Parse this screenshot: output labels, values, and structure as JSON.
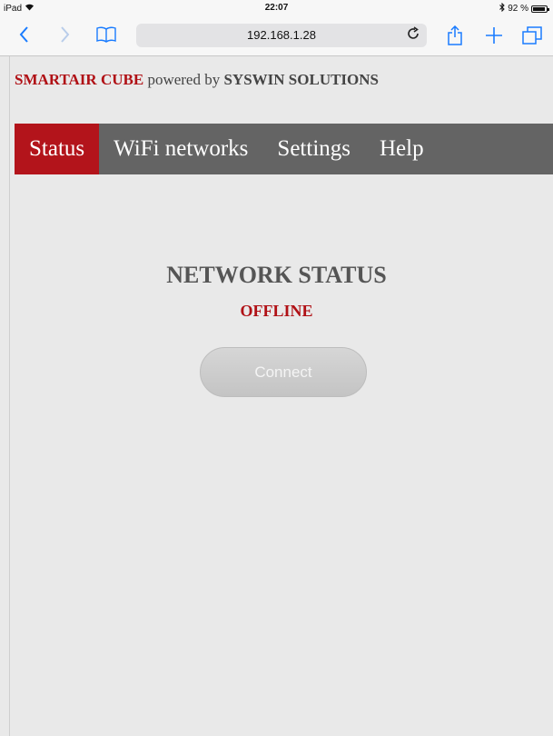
{
  "status_bar": {
    "device": "iPad",
    "time": "22:07",
    "battery_text": "92 %",
    "battery_level": 0.92
  },
  "browser": {
    "url": "192.168.1.28",
    "icons": {
      "back": "chevron-left-icon",
      "forward": "chevron-right-icon",
      "bookmarks": "book-icon",
      "reload": "reload-icon",
      "share": "share-icon",
      "new_tab": "plus-icon",
      "tabs": "tabs-icon"
    }
  },
  "brand": {
    "product": "SMARTAIR CUBE",
    "powered_by": "powered by",
    "company": "SYSWIN SOLUTIONS"
  },
  "nav": {
    "items": [
      {
        "label": "Status",
        "active": true
      },
      {
        "label": "WiFi networks",
        "active": false
      },
      {
        "label": "Settings",
        "active": false
      },
      {
        "label": "Help",
        "active": false
      }
    ]
  },
  "main": {
    "title": "NETWORK STATUS",
    "state": "OFFLINE",
    "connect_label": "Connect"
  },
  "colors": {
    "accent": "#b3141b",
    "nav_background": "#646464",
    "page_background": "#e9e9e9",
    "link_blue": "#1a7cff"
  }
}
